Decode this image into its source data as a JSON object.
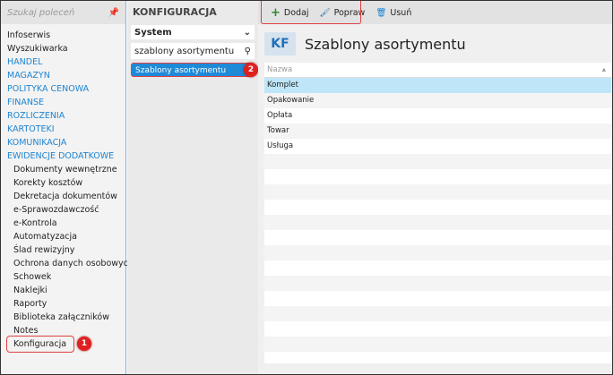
{
  "sidebar": {
    "search_placeholder": "Szukaj poleceń",
    "items": [
      {
        "label": "Infoserwis",
        "type": "item"
      },
      {
        "label": "Wyszukiwarka",
        "type": "item"
      },
      {
        "label": "HANDEL",
        "type": "sec"
      },
      {
        "label": "MAGAZYN",
        "type": "sec"
      },
      {
        "label": "POLITYKA CENOWA",
        "type": "sec"
      },
      {
        "label": "FINANSE",
        "type": "sec"
      },
      {
        "label": "ROZLICZENIA",
        "type": "sec"
      },
      {
        "label": "KARTOTEKI",
        "type": "sec"
      },
      {
        "label": "KOMUNIKACJA",
        "type": "sec"
      },
      {
        "label": "EWIDENCJE DODATKOWE",
        "type": "sec"
      },
      {
        "label": "Dokumenty wewnętrzne",
        "type": "sub"
      },
      {
        "label": "Korekty kosztów",
        "type": "sub"
      },
      {
        "label": "Dekretacja dokumentów",
        "type": "sub"
      },
      {
        "label": "e-Sprawozdawczość",
        "type": "sub"
      },
      {
        "label": "e-Kontrola",
        "type": "sub"
      },
      {
        "label": "Automatyzacja",
        "type": "sub"
      },
      {
        "label": "Ślad rewizyjny",
        "type": "sub"
      },
      {
        "label": "Ochrona danych osobowych",
        "type": "sub"
      },
      {
        "label": "Schowek",
        "type": "sub"
      },
      {
        "label": "Naklejki",
        "type": "sub"
      },
      {
        "label": "Raporty",
        "type": "sub"
      },
      {
        "label": "Biblioteka załączników",
        "type": "sub"
      },
      {
        "label": "Notes",
        "type": "sub"
      }
    ],
    "active": "Konfiguracja",
    "badge": "1"
  },
  "middle": {
    "title": "KONFIGURACJA",
    "select": "System",
    "search_value": "szablony asortymentu",
    "result": "Szablony asortymentu",
    "badge": "2"
  },
  "toolbar": {
    "add": "Dodaj",
    "edit": "Popraw",
    "delete": "Usuń"
  },
  "main": {
    "icon_text": "KF",
    "title": "Szablony asortymentu",
    "column": "Nazwa",
    "rows": [
      "Komplet",
      "Opakowanie",
      "Opłata",
      "Towar",
      "Usługa"
    ]
  }
}
